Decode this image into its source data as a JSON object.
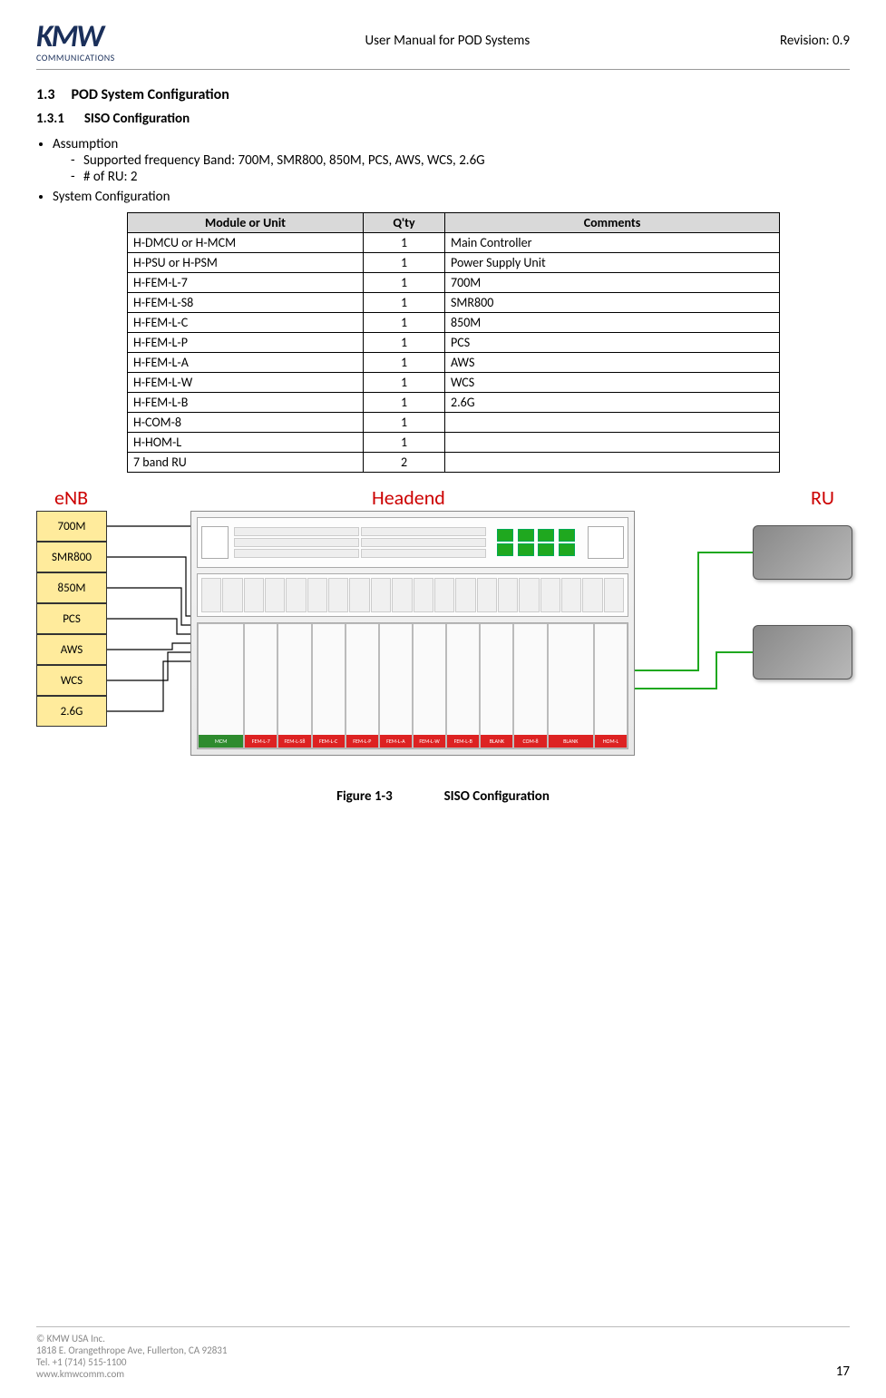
{
  "header": {
    "logo_text": "KMW",
    "logo_sub": "COMMUNICATIONS",
    "doc_title": "User Manual for POD Systems",
    "revision": "Revision: 0.9"
  },
  "sections": {
    "h1_num": "1.3",
    "h1_title": "POD System Configuration",
    "h2_num": "1.3.1",
    "h2_title": "SISO Configuration"
  },
  "bullets": {
    "b1": "Assumption",
    "b1_sub1": "Supported frequency Band: 700M, SMR800, 850M, PCS, AWS, WCS, 2.6G",
    "b1_sub2": "# of RU: 2",
    "b2": "System Configuration"
  },
  "table": {
    "headers": {
      "c1": "Module or Unit",
      "c2": "Q'ty",
      "c3": "Comments"
    },
    "rows": [
      {
        "module": "H-DMCU or H-MCM",
        "qty": "1",
        "comment": "Main Controller"
      },
      {
        "module": "H-PSU or H-PSM",
        "qty": "1",
        "comment": "Power Supply Unit"
      },
      {
        "module": "H-FEM-L-7",
        "qty": "1",
        "comment": "700M"
      },
      {
        "module": "H-FEM-L-S8",
        "qty": "1",
        "comment": "SMR800"
      },
      {
        "module": "H-FEM-L-C",
        "qty": "1",
        "comment": "850M"
      },
      {
        "module": "H-FEM-L-P",
        "qty": "1",
        "comment": "PCS"
      },
      {
        "module": "H-FEM-L-A",
        "qty": "1",
        "comment": "AWS"
      },
      {
        "module": "H-FEM-L-W",
        "qty": "1",
        "comment": "WCS"
      },
      {
        "module": "H-FEM-L-B",
        "qty": "1",
        "comment": "2.6G"
      },
      {
        "module": "H-COM-8",
        "qty": "1",
        "comment": ""
      },
      {
        "module": "H-HOM-L",
        "qty": "1",
        "comment": ""
      },
      {
        "module": "7 band RU",
        "qty": "2",
        "comment": ""
      }
    ]
  },
  "diagram": {
    "labels": {
      "enb": "eNB",
      "headend": "Headend",
      "ru": "RU"
    },
    "enb_bands": [
      "700M",
      "SMR800",
      "850M",
      "PCS",
      "AWS",
      "WCS",
      "2.6G"
    ],
    "module_labels": {
      "mcm": "MCM",
      "fem": [
        "FEM-L-7",
        "FEM-L-S8",
        "FEM-L-C",
        "FEM-L-P",
        "FEM-L-A",
        "FEM-L-W",
        "FEM-L-B"
      ],
      "blank": "BLANK",
      "com": "COM-8",
      "hom": "HOM-L"
    },
    "colors": {
      "label": "#c00",
      "enb_fill": "#ffeb9c",
      "ru_link": "#1fa81f"
    }
  },
  "figure": {
    "num": "Figure 1-3",
    "title": "SISO Configuration"
  },
  "footer": {
    "copyright": "© KMW USA Inc.",
    "addr": "1818 E. Orangethrope Ave, Fullerton, CA 92831",
    "tel": "Tel. +1 (714) 515-1100",
    "web": "www.kmwcomm.com",
    "page": "17"
  }
}
